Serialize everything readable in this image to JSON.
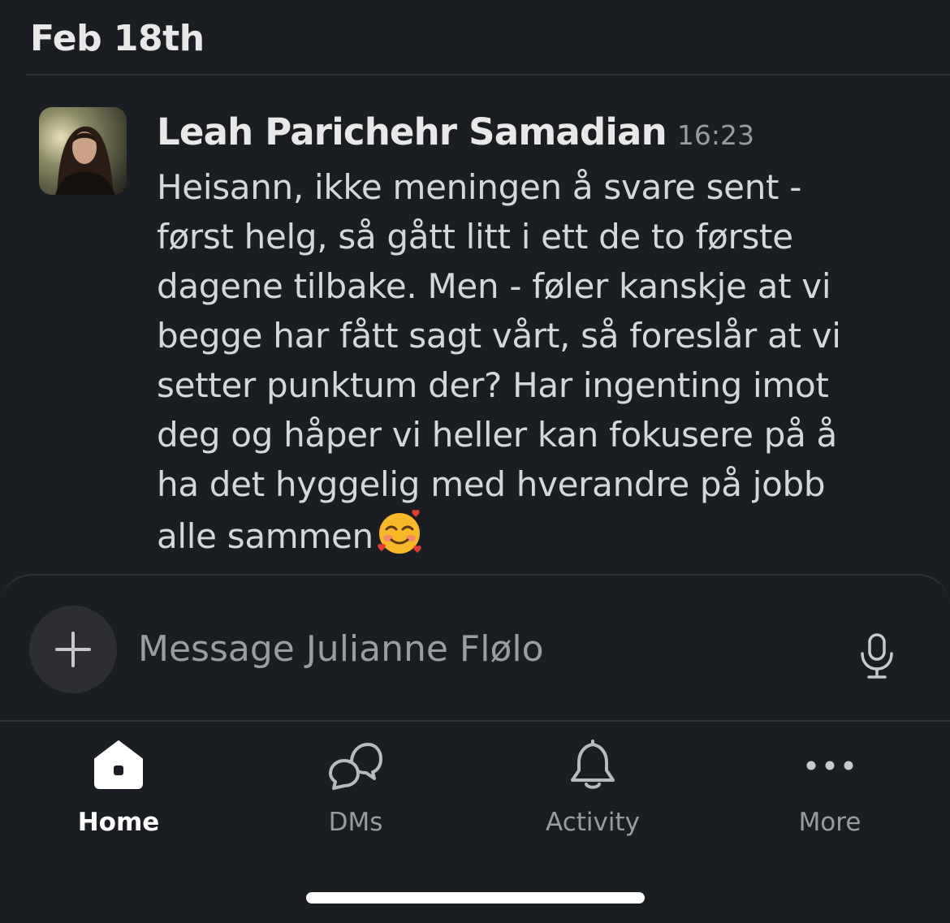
{
  "date_header": "Feb 18th",
  "message": {
    "sender": "Leah Parichehr Samadian",
    "time": "16:23",
    "lines": [
      "Heisann, ikke meningen å svare sent -",
      "først helg, så gått litt i ett de to første",
      "dagene tilbake. Men - føler kanskje at vi",
      "begge har fått sagt vårt, så foreslår at vi",
      "setter punktum der? Har ingenting imot",
      "deg og håper vi heller kan fokusere på å",
      "ha det hyggelig med hverandre på jobb",
      "alle sammen"
    ],
    "emoji": "smiling-face-with-hearts"
  },
  "composer": {
    "placeholder": "Message Julianne Flølo",
    "value": "",
    "add_icon": "plus-icon",
    "voice_icon": "microphone-icon"
  },
  "tabbar": {
    "tabs": [
      {
        "label": "Home",
        "icon": "home-icon",
        "active": true
      },
      {
        "label": "DMs",
        "icon": "dms-icon",
        "active": false
      },
      {
        "label": "Activity",
        "icon": "bell-icon",
        "active": false
      },
      {
        "label": "More",
        "icon": "more-icon",
        "active": false
      }
    ]
  },
  "colors": {
    "background": "#1a1d21",
    "divider": "#2f3236",
    "text_primary": "#e8e8e8",
    "text_secondary": "#9a9b9d"
  }
}
